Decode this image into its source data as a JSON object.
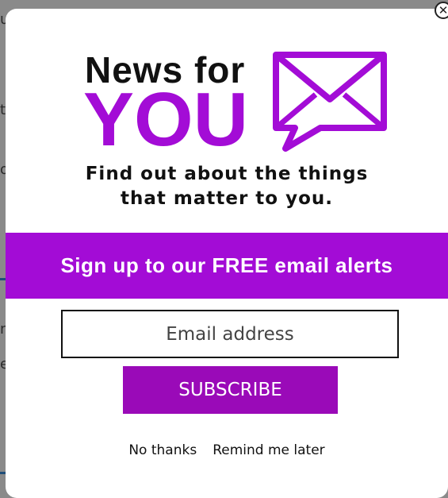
{
  "popup": {
    "logo": {
      "line1": "News for",
      "line2": "YOU"
    },
    "tagline": {
      "line1": "Find out about the things",
      "line2": "that matter to you."
    },
    "banner_text": "Sign up to our FREE email alerts",
    "email": {
      "placeholder": "Email address",
      "value": ""
    },
    "subscribe_label": "SUBSCRIBE",
    "no_thanks_label": "No thanks",
    "remind_label": "Remind me later",
    "close_glyph": "✕"
  },
  "background_fragments": [
    "u",
    "t",
    "o",
    "ni",
    "e"
  ],
  "colors": {
    "accent": "#a30cd6",
    "button": "#9a0ab8",
    "overlay": "#8a8a8a"
  }
}
